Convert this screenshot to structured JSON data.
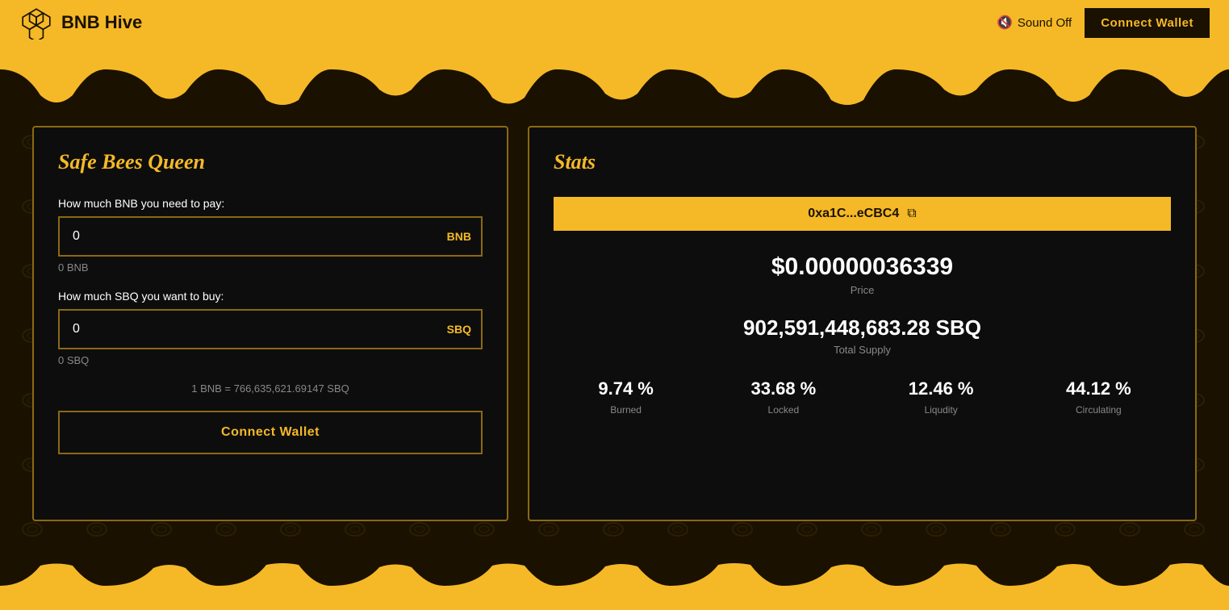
{
  "header": {
    "logo_text": "BNB Hive",
    "sound_off_label": "Sound Off",
    "connect_wallet_label": "Connect Wallet"
  },
  "left_card": {
    "title": "Safe Bees Queen",
    "bnb_label": "How much BNB you need to pay:",
    "bnb_value": "0",
    "bnb_suffix": "BNB",
    "bnb_balance": "0 BNB",
    "sbq_label": "How much SBQ you want to buy:",
    "sbq_value": "0",
    "sbq_suffix": "SBQ",
    "sbq_balance": "0 SBQ",
    "rate_text": "1 BNB = 766,635,621.69147 SBQ",
    "connect_wallet_label": "Connect Wallet"
  },
  "right_card": {
    "title": "Stats",
    "address": "0xa1C...eCBC4",
    "price_value": "$0.00000036339",
    "price_label": "Price",
    "supply_value": "902,591,448,683.28 SBQ",
    "supply_label": "Total Supply",
    "stats": [
      {
        "pct": "9.74 %",
        "label": "Burned"
      },
      {
        "pct": "33.68 %",
        "label": "Locked"
      },
      {
        "pct": "12.46 %",
        "label": "Liqudity"
      },
      {
        "pct": "44.12 %",
        "label": "Circulating"
      }
    ]
  }
}
